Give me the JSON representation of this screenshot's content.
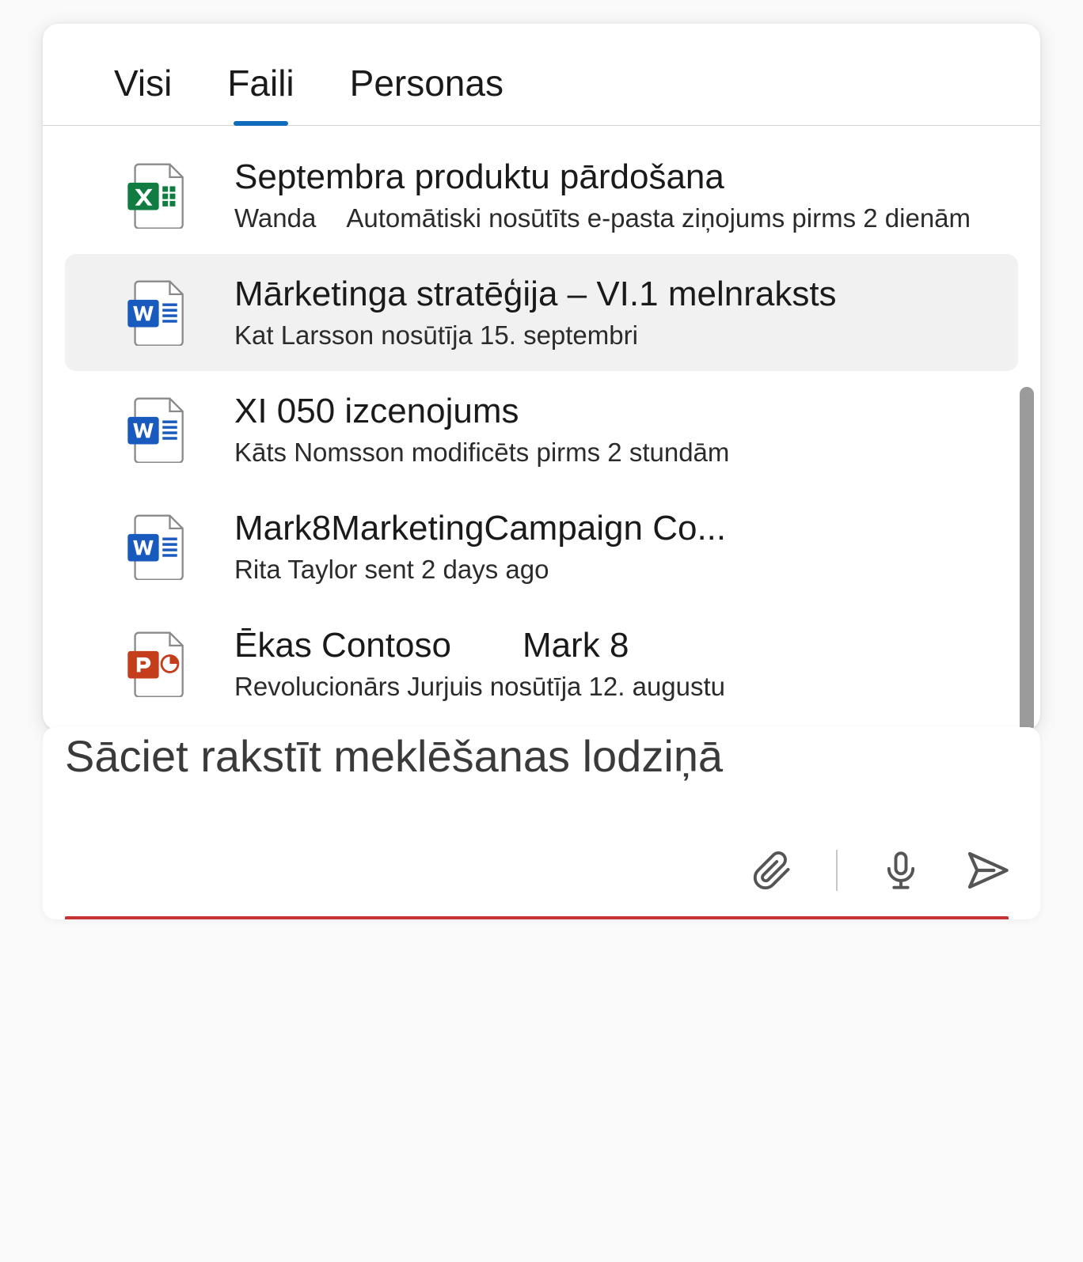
{
  "tabs": {
    "all": "Visi",
    "files": "Faili",
    "people": "Personas",
    "active_index": 1
  },
  "files": [
    {
      "icon": "excel",
      "title": "Septembra produktu pārdošana",
      "meta1": "Wanda",
      "meta2": "Automātiski nosūtīts e-pasta ziņojums pirms 2 dienām"
    },
    {
      "icon": "word",
      "title": "Mārketinga stratēģija – VI.1 melnraksts",
      "meta1": "Kat Larsson nosūtīja 15. septembri",
      "meta2": "",
      "hovered": true
    },
    {
      "icon": "word",
      "title": "XI 050 izcenojums",
      "meta1": "Kāts Nomsson modificēts pirms 2 stundām",
      "meta2": ""
    },
    {
      "icon": "word",
      "title": "Mark8MarketingCampaign Co...",
      "meta1": "Rita Taylor sent 2 days ago",
      "meta2": ""
    },
    {
      "icon": "powerpoint",
      "title": "Ēkas Contoso",
      "title_extra": "Mark 8",
      "meta1": "Revolucionārs Jurjuis nosūtīja 12. augustu",
      "meta2": ""
    }
  ],
  "compose": {
    "placeholder": "Sāciet rakstīt meklēšanas lodziņā"
  }
}
